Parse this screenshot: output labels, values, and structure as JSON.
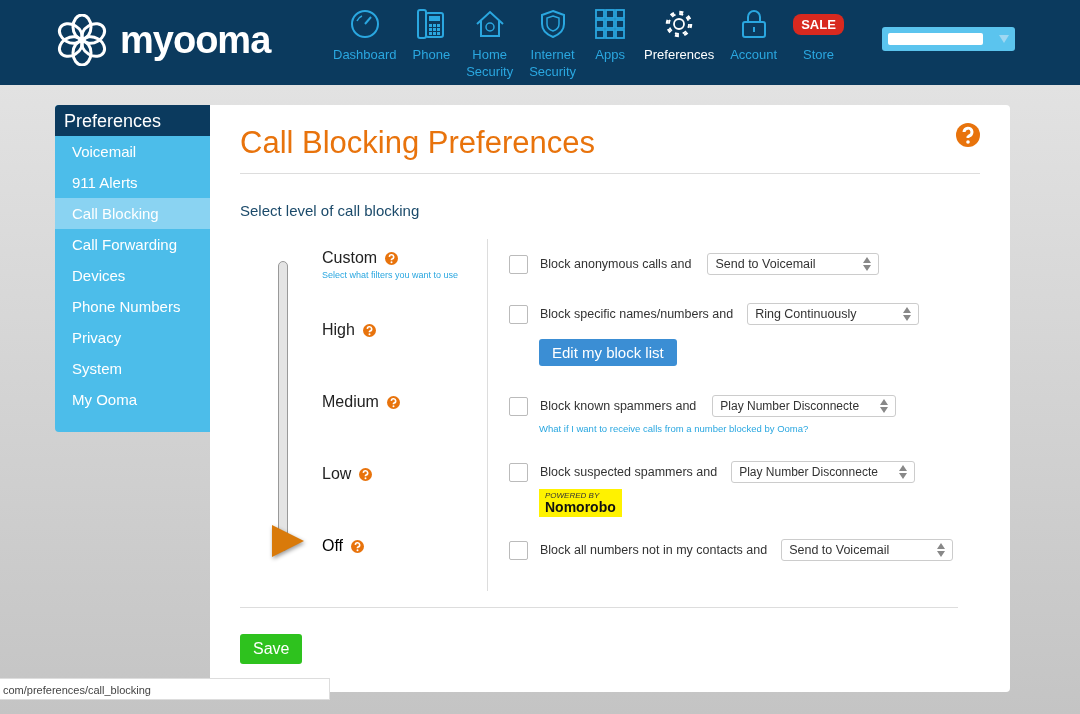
{
  "header": {
    "logo_text": "myooma",
    "nav": [
      {
        "label": "Dashboard",
        "selected": false
      },
      {
        "label": "Phone",
        "selected": false
      },
      {
        "label": "Home Security",
        "selected": false
      },
      {
        "label": "Internet Security",
        "selected": false
      },
      {
        "label": "Apps",
        "selected": false
      },
      {
        "label": "Preferences",
        "selected": true
      },
      {
        "label": "Account",
        "selected": false
      },
      {
        "badge": "SALE",
        "label": "Store",
        "selected": false
      }
    ]
  },
  "sidebar": {
    "title": "Preferences",
    "items": [
      {
        "label": "Voicemail",
        "selected": false
      },
      {
        "label": "911 Alerts",
        "selected": false
      },
      {
        "label": "Call Blocking",
        "selected": true
      },
      {
        "label": "Call Forwarding",
        "selected": false
      },
      {
        "label": "Devices",
        "selected": false
      },
      {
        "label": "Phone Numbers",
        "selected": false
      },
      {
        "label": "Privacy",
        "selected": false
      },
      {
        "label": "System",
        "selected": false
      },
      {
        "label": "My Ooma",
        "selected": false
      }
    ]
  },
  "page": {
    "title": "Call Blocking Preferences",
    "subtitle": "Select level of call blocking"
  },
  "levels": [
    {
      "label": "Custom",
      "hint": "Select what filters you want to use",
      "selected": false
    },
    {
      "label": "High",
      "selected": false
    },
    {
      "label": "Medium",
      "selected": false
    },
    {
      "label": "Low",
      "selected": false
    },
    {
      "label": "Off",
      "selected": true
    }
  ],
  "options": [
    {
      "kind": "plain",
      "label": "Block anonymous calls and",
      "checked": false,
      "action": "Send to Voicemail"
    },
    {
      "kind": "button",
      "label": "Block specific names/numbers and",
      "checked": false,
      "action": "Ring Continuously",
      "button": "Edit my block list"
    },
    {
      "kind": "link",
      "label": "Block known spammers and",
      "checked": false,
      "action": "Play Number Disconnecte",
      "link": "What if I want to receive calls from a number blocked by Ooma?"
    },
    {
      "kind": "badge",
      "label": "Block suspected spammers and",
      "checked": false,
      "action": "Play Number Disconnecte",
      "badge_small": "POWERED BY",
      "badge_big": "Nomorobo"
    },
    {
      "kind": "plain",
      "label": "Block all numbers not in my contacts and",
      "checked": false,
      "action": "Send to Voicemail"
    }
  ],
  "save_button": "Save",
  "status_url": "com/preferences/call_blocking"
}
